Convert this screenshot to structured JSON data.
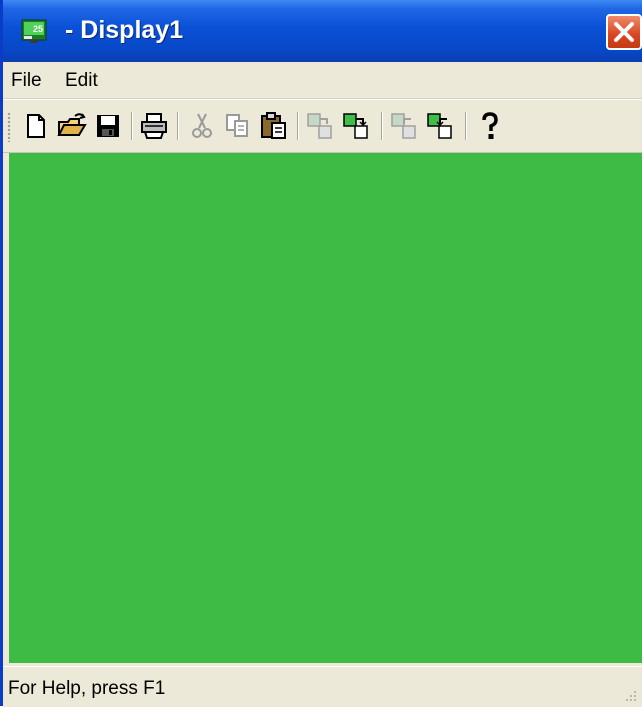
{
  "window": {
    "title": " - Display1",
    "app_icon": "green-monitor-icon",
    "title_bar_color": "#0a50d6",
    "close_icon": "close-x-icon",
    "close_button_color": "#d9451f"
  },
  "menubar": {
    "items": [
      {
        "label": "File"
      },
      {
        "label": "Edit"
      }
    ]
  },
  "toolbar": {
    "buttons": [
      {
        "icon": "new-document-icon",
        "enabled": true
      },
      {
        "icon": "open-folder-icon",
        "enabled": true
      },
      {
        "icon": "save-disk-icon",
        "enabled": true
      },
      {
        "icon": "printer-icon",
        "enabled": true
      },
      {
        "icon": "cut-scissors-icon",
        "enabled": false
      },
      {
        "icon": "copy-icon",
        "enabled": false
      },
      {
        "icon": "paste-clipboard-icon",
        "enabled": true
      },
      {
        "icon": "export-display-icon",
        "enabled": false
      },
      {
        "icon": "import-display-icon",
        "enabled": true
      },
      {
        "icon": "export-alt-icon",
        "enabled": false
      },
      {
        "icon": "import-alt-icon",
        "enabled": true
      },
      {
        "icon": "help-question-icon",
        "enabled": true
      }
    ]
  },
  "client_area": {
    "background_color": "#3dbb44"
  },
  "statusbar": {
    "text": "For Help, press F1"
  }
}
